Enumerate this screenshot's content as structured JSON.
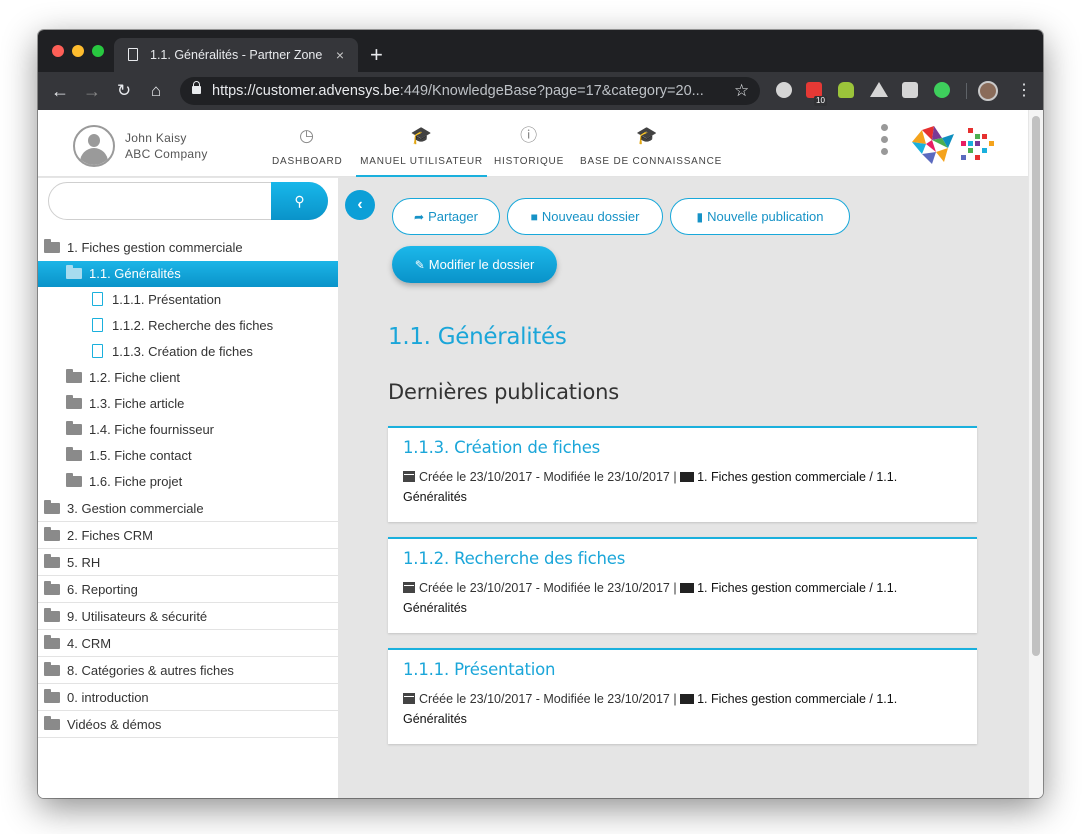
{
  "browser": {
    "tab_title": "1.1. Généralités - Partner Zone",
    "tab_close": "×",
    "new_tab": "+",
    "url_host": "https://customer.advensys.be",
    "url_rest": ":449/KnowledgeBase?page=17&category=20...",
    "ext_badge": "10",
    "icons": [
      "back-arrow-icon",
      "forward-arrow-icon",
      "reload-icon",
      "home-icon",
      "lock-icon",
      "star-icon",
      "gear-extension-icon",
      "android-extension-icon",
      "drive-extension-icon",
      "camera-extension-icon",
      "sync-extension-icon",
      "profile-avatar",
      "menu-kebab-icon"
    ]
  },
  "user": {
    "name": "John Kaisy",
    "company": "ABC Company"
  },
  "nav": {
    "tabs": [
      {
        "label": "DASHBOARD",
        "icon": "speedometer-icon"
      },
      {
        "label": "MANUEL UTILISATEUR",
        "icon": "graduation-cap-icon"
      },
      {
        "label": "HISTORIQUE",
        "icon": "info-icon"
      },
      {
        "label": "BASE DE CONNAISSANCE",
        "icon": "graduation-cap-icon"
      }
    ],
    "active_index": 1
  },
  "sidebar": {
    "search": {
      "placeholder": "",
      "value": ""
    },
    "tree": [
      {
        "label": "1. Fiches gestion commerciale",
        "type": "folder",
        "level": 0
      },
      {
        "label": "1.1. Généralités",
        "type": "folder",
        "level": 1,
        "active": true
      },
      {
        "label": "1.1.1. Présentation",
        "type": "file",
        "level": 2
      },
      {
        "label": "1.1.2. Recherche des fiches",
        "type": "file",
        "level": 2
      },
      {
        "label": "1.1.3. Création de fiches",
        "type": "file",
        "level": 2
      },
      {
        "label": "1.2. Fiche client",
        "type": "folder",
        "level": 1
      },
      {
        "label": "1.3. Fiche article",
        "type": "folder",
        "level": 1
      },
      {
        "label": "1.4. Fiche fournisseur",
        "type": "folder",
        "level": 1
      },
      {
        "label": "1.5. Fiche contact",
        "type": "folder",
        "level": 1
      },
      {
        "label": "1.6. Fiche projet",
        "type": "folder",
        "level": 1
      },
      {
        "label": "3. Gestion commerciale",
        "type": "folder",
        "level": 0
      },
      {
        "label": "2. Fiches CRM",
        "type": "folder",
        "level": 0
      },
      {
        "label": "5. RH",
        "type": "folder",
        "level": 0
      },
      {
        "label": "6. Reporting",
        "type": "folder",
        "level": 0
      },
      {
        "label": "9. Utilisateurs & sécurité",
        "type": "folder",
        "level": 0
      },
      {
        "label": "4. CRM",
        "type": "folder",
        "level": 0
      },
      {
        "label": "8. Catégories & autres fiches",
        "type": "folder",
        "level": 0
      },
      {
        "label": "0. introduction",
        "type": "folder",
        "level": 0
      },
      {
        "label": "Vidéos & démos",
        "type": "folder",
        "level": 0
      }
    ]
  },
  "actions": {
    "share": "Partager",
    "new_folder": "Nouveau dossier",
    "new_publication": "Nouvelle publication",
    "edit_folder": "Modifier le dossier"
  },
  "main": {
    "title": "1.1. Généralités",
    "section_title": "Dernières publications",
    "cards": [
      {
        "title": "1.1.3. Création de fiches",
        "meta": "Créée le 23/10/2017 - Modifiée le 23/10/2017 |",
        "path": "1. Fiches gestion commerciale / 1.1.",
        "path_end": "Généralités"
      },
      {
        "title": "1.1.2. Recherche des fiches",
        "meta": "Créée le 23/10/2017 - Modifiée le 23/10/2017 |",
        "path": "1. Fiches gestion commerciale / 1.1.",
        "path_end": "Généralités"
      },
      {
        "title": "1.1.1. Présentation",
        "meta": "Créée le 23/10/2017 - Modifiée le 23/10/2017 |",
        "path": "1. Fiches gestion commerciale / 1.1.",
        "path_end": "Généralités"
      }
    ]
  },
  "colors": {
    "accent": "#1ab0dd",
    "accent_dark": "#0a93c9",
    "sidebar_bg": "#ffffff",
    "content_bg": "#e5e5e5",
    "browser_dark": "#35363a"
  }
}
